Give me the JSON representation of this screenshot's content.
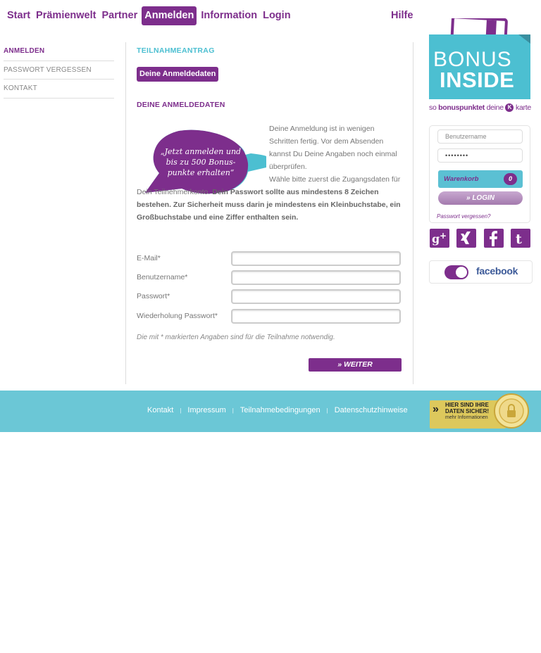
{
  "topnav": {
    "items": [
      {
        "label": "Start"
      },
      {
        "label": "Prämienwelt"
      },
      {
        "label": "Partner"
      },
      {
        "label": "Anmelden",
        "active": true
      },
      {
        "label": "Information"
      },
      {
        "label": "Login"
      }
    ],
    "help": "Hilfe"
  },
  "sidebar": {
    "items": [
      {
        "label": "ANMELDEN",
        "active": true
      },
      {
        "label": "PASSWORT VERGESSEN"
      },
      {
        "label": "KONTAKT"
      }
    ]
  },
  "main": {
    "heading": "TEILNAHMEANTRAG",
    "tab_label": "Deine Anmeldedaten",
    "section_heading": "DEINE ANMELDEDATEN",
    "promo_text": "„Jetzt anmelden und bis zu 500 Bonus-punkte erhalten“",
    "intro_1": "Deine Anmeldung ist in wenigen Schritten fertig. Vor dem Absenden kannst Du Deine Angaben noch einmal überprüfen.",
    "intro_2a": "Wähle bitte zuerst die Zugangsdaten für Dein Teilnehmerkonto.",
    "intro_2b": "Dein Passwort sollte aus mindestens 8 Zeichen bestehen. Zur Sicherheit muss darin je mindestens ein Kleinbuchstabe, ein Großbuchstabe und eine Ziffer enthalten sein.",
    "fields": {
      "email": "E-Mail*",
      "username": "Benutzername*",
      "password": "Passwort*",
      "password_repeat": "Wiederholung Passwort*"
    },
    "note": "Die mit * markierten Angaben sind für die Teilnahme notwendig.",
    "submit": "» WEITER"
  },
  "logo": {
    "line1": "BONUS",
    "line2": "INSIDE",
    "tagline_prefix": "so",
    "tagline_bold": "bonuspunktet",
    "tagline_suffix": "deine",
    "tagline_end": "karte"
  },
  "login": {
    "username_placeholder": "Benutzername",
    "password_value": "••••••••",
    "cart_label": "Warenkorb",
    "cart_count": "0",
    "login_button": "» LOGIN",
    "forgot_link": "Passwort vergessen?"
  },
  "social": {
    "icons": [
      "google-plus-icon",
      "xing-icon",
      "facebook-icon",
      "twitter-icon"
    ],
    "facebook_toggle_label": "facebook"
  },
  "footer": {
    "links": [
      "Kontakt",
      "Impressum",
      "Teilnahmebedingungen",
      "Datenschutzhinweise"
    ],
    "seal_line1": "HIER SIND IHRE",
    "seal_line2": "DATEN SICHER!",
    "seal_line3": "mehr Informationen"
  },
  "colors": {
    "purple": "#7d2e8c",
    "teal": "#4cbfd1",
    "footer": "#6bc7d6"
  }
}
